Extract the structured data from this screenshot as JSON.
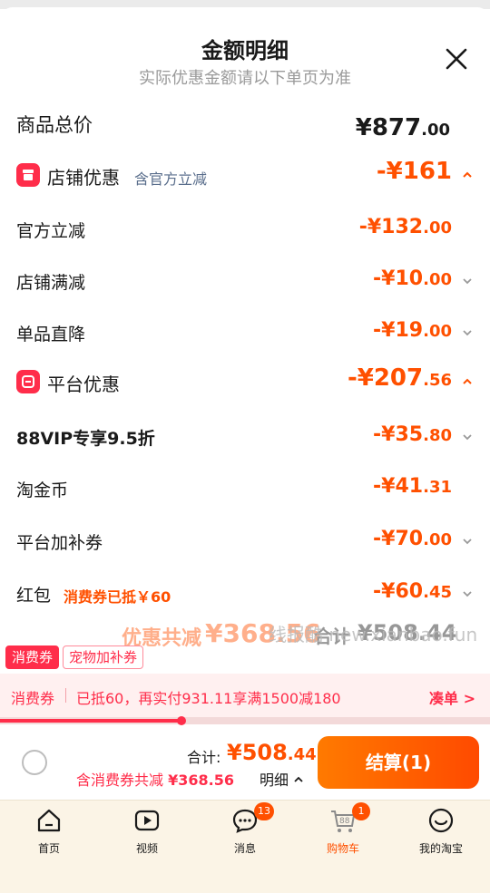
{
  "header": {
    "title": "金额明细",
    "subtitle": "实际优惠金额请以下单页为准"
  },
  "summary": {
    "label": "商品总价",
    "amount_main": "¥877",
    "amount_dec": ".00"
  },
  "shop_discount": {
    "label": "店铺优惠",
    "note": "含官方立减",
    "amount": "-¥161",
    "items": [
      {
        "label": "官方立减",
        "amount_main": "-¥132",
        "amount_dec": ".00"
      },
      {
        "label": "店铺满减",
        "amount_main": "-¥10",
        "amount_dec": ".00"
      },
      {
        "label": "单品直降",
        "amount_main": "-¥19",
        "amount_dec": ".00"
      }
    ]
  },
  "platform_discount": {
    "label": "平台优惠",
    "amount_main": "-¥207",
    "amount_dec": ".56",
    "items": [
      {
        "label": "88VIP专享9.5折",
        "amount_main": "-¥35",
        "amount_dec": ".80"
      },
      {
        "label": "淘金币",
        "amount_main": "-¥41",
        "amount_dec": ".31"
      },
      {
        "label": "平台加补券",
        "amount_main": "-¥70",
        "amount_dec": ".00"
      },
      {
        "label": "红包",
        "note": "消费券已抵￥60",
        "amount_main": "-¥60",
        "amount_dec": ".45"
      }
    ]
  },
  "overlay_total": {
    "discount_label": "优惠共减",
    "discount_amount": "¥368.56",
    "total_label": "合计",
    "total_amount": "¥508.44"
  },
  "watermark": "线报酷 new.xianbao.fun",
  "tags": [
    "消费券",
    "宠物加补券"
  ],
  "promo": {
    "label": "消费券",
    "message": "已抵60，再实付931.11享满1500减180",
    "link": "凑单 >",
    "progress": 0.37
  },
  "checkout": {
    "sum_label": "合计:",
    "sum_main": "¥508",
    "sum_dec": ".44",
    "discount_prefix": "含消费券共减",
    "discount_amount": "¥368.56",
    "detail_link": "明细",
    "button": "结算(1)"
  },
  "tabbar": [
    {
      "label": "首页",
      "icon": "home-icon"
    },
    {
      "label": "视频",
      "icon": "video-icon"
    },
    {
      "label": "消息",
      "icon": "message-icon",
      "badge": "13"
    },
    {
      "label": "购物车",
      "icon": "cart-icon",
      "badge": "1",
      "active": true
    },
    {
      "label": "我的淘宝",
      "icon": "profile-icon"
    }
  ],
  "colors": {
    "accent": "#ff5000",
    "red": "#ff2d4a"
  }
}
